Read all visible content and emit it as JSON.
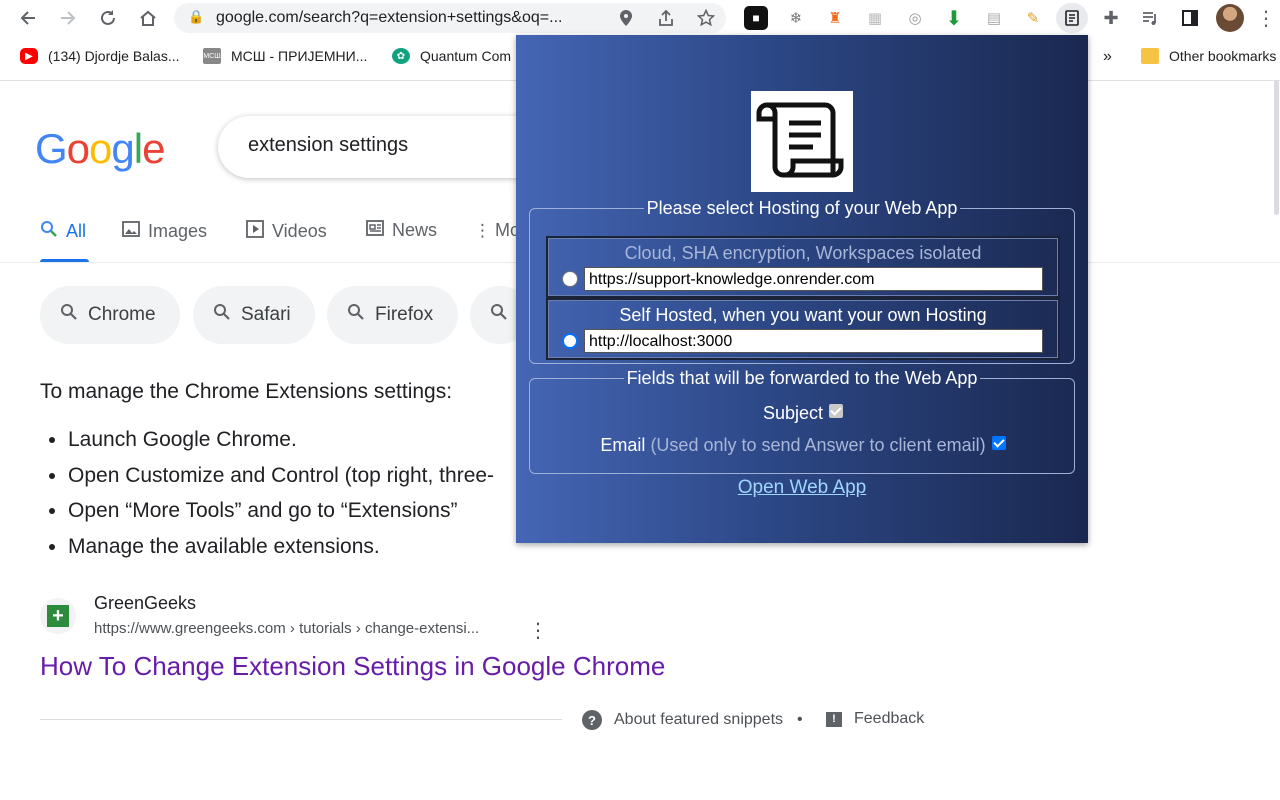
{
  "browser": {
    "url": "google.com/search?q=extension+settings&oq=...",
    "bookmarks": [
      {
        "label": "(134) Djordje Balas..."
      },
      {
        "label": "МСШ - ПРИЈЕМНИ..."
      },
      {
        "label": "Quantum Com"
      },
      {
        "label": "Other bookmarks"
      }
    ],
    "overflow_label": "»"
  },
  "google": {
    "logo": "Google",
    "query": "extension settings",
    "tabs": [
      {
        "label": "All"
      },
      {
        "label": "Images"
      },
      {
        "label": "Videos"
      },
      {
        "label": "News"
      },
      {
        "label": "Mo"
      }
    ],
    "chips": [
      "Chrome",
      "Safari",
      "Firefox"
    ],
    "featured_title": "To manage the Chrome Extensions settings:",
    "featured_steps": [
      "Launch Google Chrome.",
      "Open Customize and Control (top right, three-",
      "Open “More Tools” and go to “Extensions”",
      "Manage the available extensions."
    ],
    "result": {
      "site": "GreenGeeks",
      "url": "https://www.greengeeks.com › tutorials › change-extensi...",
      "title": "How To Change Extension Settings in Google Chrome"
    },
    "about_snippets": "About featured snippets",
    "separator": "•",
    "feedback": "Feedback"
  },
  "popup": {
    "hosting_legend": "Please select Hosting of your Web App",
    "options": [
      {
        "title": "Cloud, SHA encryption, Workspaces isolated",
        "value": "https://support-knowledge.onrender.com",
        "selected": false
      },
      {
        "title": "Self Hosted, when you want your own Hosting",
        "value": "http://localhost:3000",
        "selected": true
      }
    ],
    "fields_legend": "Fields that will be forwarded to the Web App",
    "subject_label": "Subject",
    "email_label": "Email",
    "email_note": "(Used only to send Answer to client email)",
    "open_link": "Open Web App"
  }
}
